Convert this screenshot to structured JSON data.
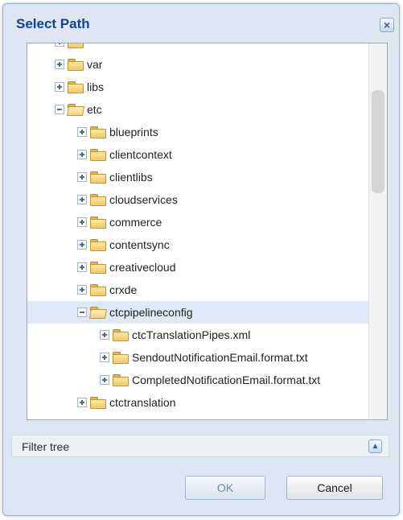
{
  "dialog": {
    "title": "Select Path",
    "close_glyph": "×"
  },
  "tree": {
    "rows": [
      {
        "label": "",
        "state": "collapsed",
        "level": 1
      },
      {
        "label": "var",
        "state": "collapsed",
        "level": 1
      },
      {
        "label": "libs",
        "state": "collapsed",
        "level": 1
      },
      {
        "label": "etc",
        "state": "expanded",
        "level": 1
      },
      {
        "label": "blueprints",
        "state": "collapsed",
        "level": 2
      },
      {
        "label": "clientcontext",
        "state": "collapsed",
        "level": 2
      },
      {
        "label": "clientlibs",
        "state": "collapsed",
        "level": 2
      },
      {
        "label": "cloudservices",
        "state": "collapsed",
        "level": 2
      },
      {
        "label": "commerce",
        "state": "collapsed",
        "level": 2
      },
      {
        "label": "contentsync",
        "state": "collapsed",
        "level": 2
      },
      {
        "label": "creativecloud",
        "state": "collapsed",
        "level": 2
      },
      {
        "label": "crxde",
        "state": "collapsed",
        "level": 2
      },
      {
        "label": "ctcpipelineconfig",
        "state": "expanded",
        "level": 2,
        "selected": true
      },
      {
        "label": "ctcTranslationPipes.xml",
        "state": "collapsed",
        "level": 3
      },
      {
        "label": "SendoutNotificationEmail.format.txt",
        "state": "collapsed",
        "level": 3
      },
      {
        "label": "CompletedNotificationEmail.format.txt",
        "state": "collapsed",
        "level": 3
      },
      {
        "label": "ctctranslation",
        "state": "collapsed",
        "level": 2
      }
    ]
  },
  "filter": {
    "label": "Filter tree",
    "toggle_icon": "chevron-up-icon"
  },
  "buttons": {
    "ok": "OK",
    "cancel": "Cancel"
  },
  "colors": {
    "title_text": "#15428b",
    "selected_row": "#dfe8f6",
    "dialog_bg": "#dde6f2"
  }
}
